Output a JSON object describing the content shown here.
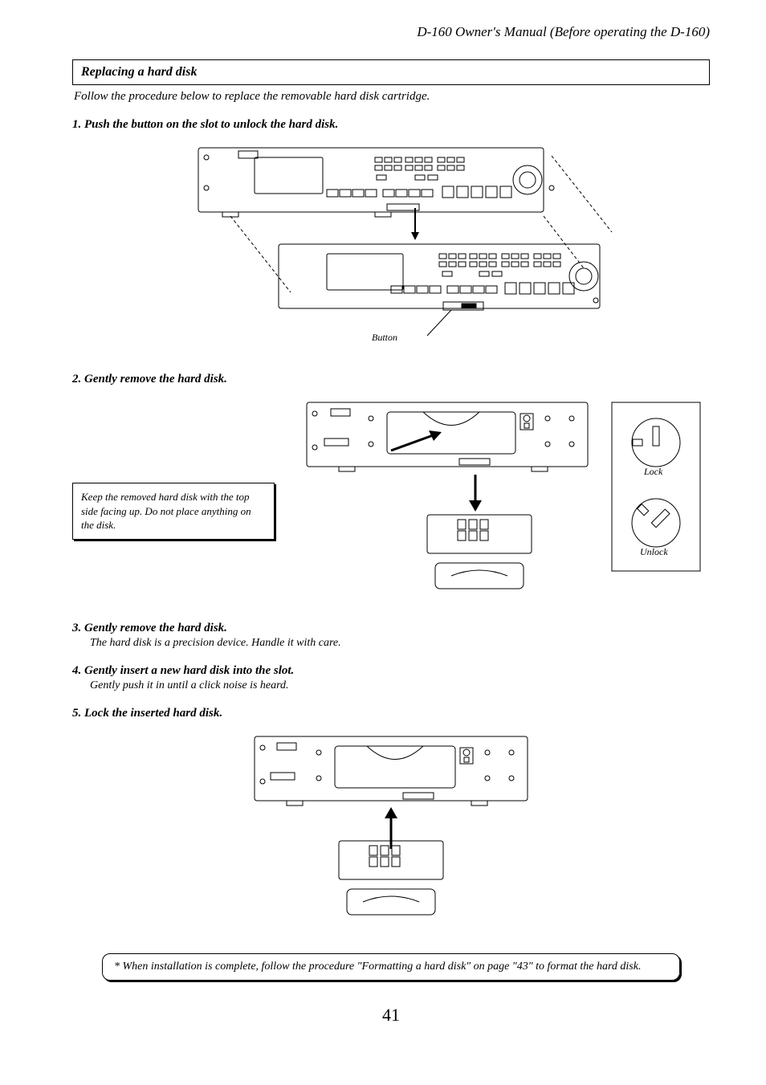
{
  "header": {
    "title": "D-160 Owner's Manual (Before operating the D-160)"
  },
  "section": {
    "heading": "Replacing a hard disk"
  },
  "intro": "Follow the procedure below to replace the removable hard disk cartridge.",
  "step1": {
    "heading": "1. Push the button on the slot to unlock the hard disk.",
    "label_button": "Button"
  },
  "step2": {
    "heading": "2. Gently remove the hard disk.",
    "textbox": "Keep the removed hard disk with the top side facing up. Do not place anything on the disk.",
    "label_lock": "Lock",
    "label_unlock": "Unlock"
  },
  "step3": {
    "heading": "3. Gently remove the hard disk.",
    "body": "The hard disk is a precision device.  Handle it with care."
  },
  "step4": {
    "heading": "4. Gently insert a new hard disk into the slot.",
    "body": "Gently push it in until a click noise is heard."
  },
  "step5": {
    "heading": "5. Lock the inserted hard disk."
  },
  "note": "*  When installation is complete, follow the procedure \"Formatting a hard disk\" on page \"43\" to format the hard disk.",
  "page_number": "41"
}
